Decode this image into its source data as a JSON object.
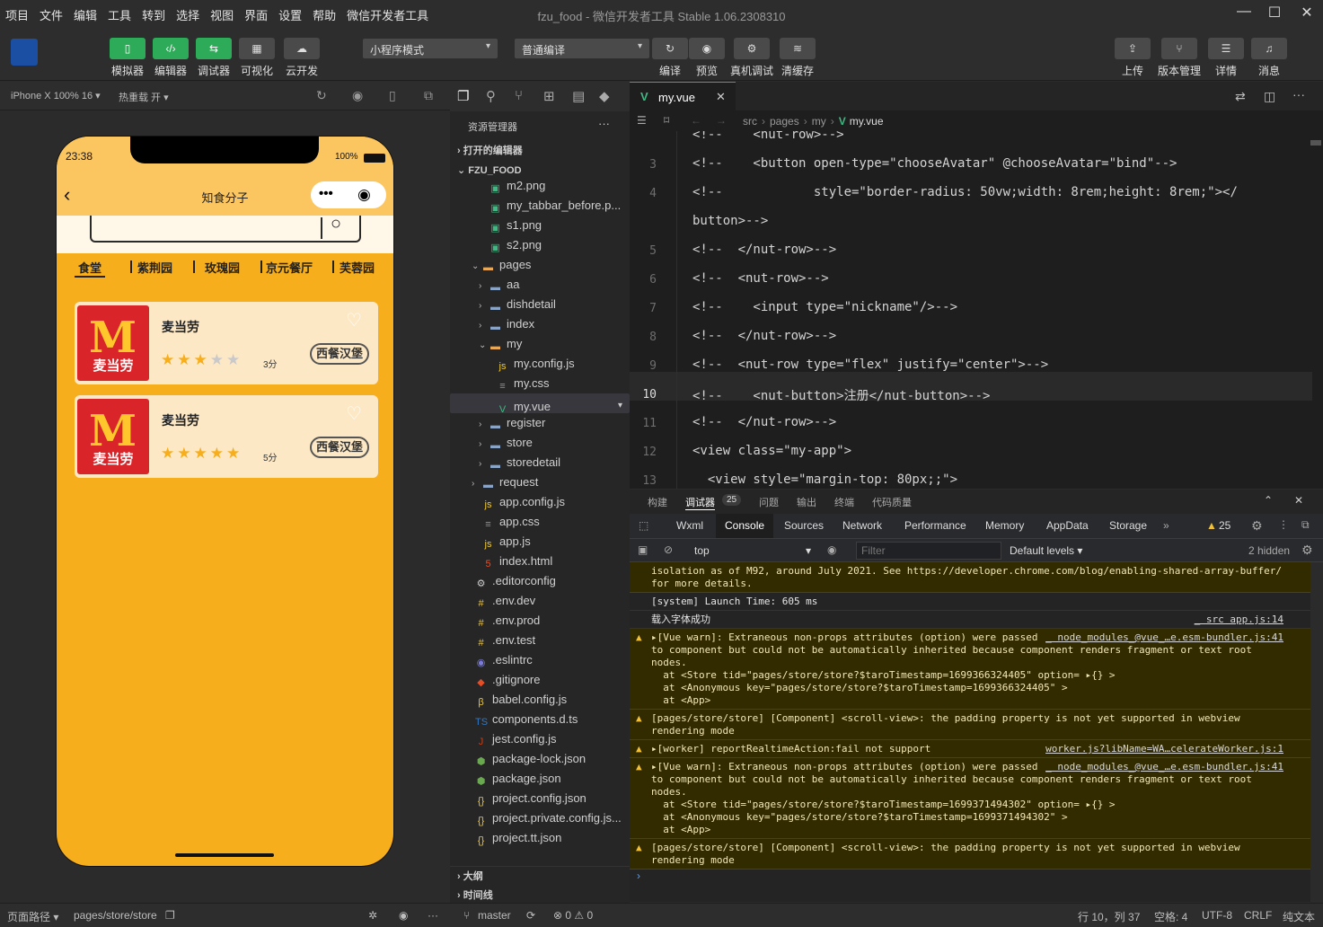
{
  "menu": [
    "项目",
    "文件",
    "编辑",
    "工具",
    "转到",
    "选择",
    "视图",
    "界面",
    "设置",
    "帮助",
    "微信开发者工具"
  ],
  "window_title": "fzu_food - 微信开发者工具 Stable 1.06.2308310",
  "toolbar": {
    "left": [
      {
        "label": "模拟器"
      },
      {
        "label": "编辑器"
      },
      {
        "label": "调试器"
      },
      {
        "label": "可视化"
      },
      {
        "label": "云开发"
      }
    ],
    "mode_select": "小程序模式",
    "compile_select": "普通编译",
    "mid": [
      {
        "label": "编译"
      },
      {
        "label": "预览"
      },
      {
        "label": "真机调试"
      },
      {
        "label": "清缓存"
      }
    ],
    "right": [
      {
        "label": "上传"
      },
      {
        "label": "版本管理"
      },
      {
        "label": "详情"
      },
      {
        "label": "消息"
      }
    ]
  },
  "sim": {
    "device": "iPhone X 100% 16 ▾",
    "hotreload": "热重载 开 ▾"
  },
  "phone": {
    "time": "23:38",
    "battery": "100%",
    "title": "知食分子",
    "tabs": [
      "食堂",
      "紫荆园",
      "玫瑰园",
      "京元餐厅",
      "芙蓉园"
    ],
    "cards": [
      {
        "name": "麦当劳",
        "logo_text": "麦当劳",
        "rating": 3,
        "score": "3分",
        "tag": "西餐汉堡"
      },
      {
        "name": "麦当劳",
        "logo_text": "麦当劳",
        "rating": 5,
        "score": "5分",
        "tag": "西餐汉堡"
      }
    ]
  },
  "explorer": {
    "title": "资源管理器",
    "open_editors": "打开的编辑器",
    "project": "FZU_FOOD",
    "items": [
      {
        "name": "m2.png",
        "depth": 3,
        "type": "img"
      },
      {
        "name": "my_tabbar_before.p...",
        "depth": 3,
        "type": "img"
      },
      {
        "name": "s1.png",
        "depth": 3,
        "type": "img"
      },
      {
        "name": "s2.png",
        "depth": 3,
        "type": "img"
      },
      {
        "name": "pages",
        "depth": 2,
        "type": "folder-open"
      },
      {
        "name": "aa",
        "depth": 3,
        "type": "folder"
      },
      {
        "name": "dishdetail",
        "depth": 3,
        "type": "folder"
      },
      {
        "name": "index",
        "depth": 3,
        "type": "folder"
      },
      {
        "name": "my",
        "depth": 3,
        "type": "folder-open"
      },
      {
        "name": "my.config.js",
        "depth": 4,
        "type": "js"
      },
      {
        "name": "my.css",
        "depth": 4,
        "type": "css"
      },
      {
        "name": "my.vue",
        "depth": 4,
        "type": "vue"
      },
      {
        "name": "register",
        "depth": 3,
        "type": "folder"
      },
      {
        "name": "store",
        "depth": 3,
        "type": "folder"
      },
      {
        "name": "storedetail",
        "depth": 3,
        "type": "folder"
      },
      {
        "name": "request",
        "depth": 2,
        "type": "folder"
      },
      {
        "name": "app.config.js",
        "depth": 2,
        "type": "js"
      },
      {
        "name": "app.css",
        "depth": 2,
        "type": "css"
      },
      {
        "name": "app.js",
        "depth": 2,
        "type": "js"
      },
      {
        "name": "index.html",
        "depth": 2,
        "type": "html"
      },
      {
        "name": ".editorconfig",
        "depth": 1,
        "type": "gear"
      },
      {
        "name": ".env.dev",
        "depth": 1,
        "type": "env"
      },
      {
        "name": ".env.prod",
        "depth": 1,
        "type": "env"
      },
      {
        "name": ".env.test",
        "depth": 1,
        "type": "env"
      },
      {
        "name": ".eslintrc",
        "depth": 1,
        "type": "eslint"
      },
      {
        "name": ".gitignore",
        "depth": 1,
        "type": "git"
      },
      {
        "name": "babel.config.js",
        "depth": 1,
        "type": "babel"
      },
      {
        "name": "components.d.ts",
        "depth": 1,
        "type": "ts"
      },
      {
        "name": "jest.config.js",
        "depth": 1,
        "type": "jest"
      },
      {
        "name": "package-lock.json",
        "depth": 1,
        "type": "node"
      },
      {
        "name": "package.json",
        "depth": 1,
        "type": "node"
      },
      {
        "name": "project.config.json",
        "depth": 1,
        "type": "json"
      },
      {
        "name": "project.private.config.js...",
        "depth": 1,
        "type": "json"
      },
      {
        "name": "project.tt.json",
        "depth": 1,
        "type": "json"
      }
    ],
    "outline": "大纲",
    "timeline": "时间线"
  },
  "editor": {
    "tab": "my.vue",
    "breadcrumb": [
      "src",
      "pages",
      "my",
      "my.vue"
    ],
    "lines": [
      {
        "n": "",
        "text": "<!--    <nut-row>-->"
      },
      {
        "n": "3",
        "text": "<!--    <button open-type=\"chooseAvatar\" @chooseAvatar=\"bind\"-->"
      },
      {
        "n": "4",
        "text": "<!--            style=\"border-radius: 50vw;width: 8rem;height: 8rem;\"></"
      },
      {
        "n": "",
        "text": "button>-->"
      },
      {
        "n": "5",
        "text": "<!--  </nut-row>-->"
      },
      {
        "n": "6",
        "text": "<!--  <nut-row>-->"
      },
      {
        "n": "7",
        "text": "<!--    <input type=\"nickname\"/>-->"
      },
      {
        "n": "8",
        "text": "<!--  </nut-row>-->"
      },
      {
        "n": "9",
        "text": "<!--  <nut-row type=\"flex\" justify=\"center\">-->"
      },
      {
        "n": "10",
        "text": "<!--    <nut-button>注册</nut-button>-->"
      },
      {
        "n": "11",
        "text": "<!--  </nut-row>-->"
      },
      {
        "n": "12",
        "text": "<view class=\"my-app\">"
      },
      {
        "n": "13",
        "text": "  <view style=\"margin-top: 80px;;\">"
      }
    ]
  },
  "panel": {
    "tabs": [
      "构建",
      "调试器",
      "问题",
      "输出",
      "终端",
      "代码质量"
    ],
    "badge": "25",
    "devtabs": [
      "Wxml",
      "Console",
      "Sources",
      "Network",
      "Performance",
      "Memory",
      "AppData",
      "Storage"
    ],
    "warn_count": "25",
    "context": "top",
    "filter_placeholder": "Filter",
    "levels": "Default levels ▾",
    "hidden": "2 hidden"
  },
  "console": [
    {
      "type": "warn",
      "lines": [
        "isolation as of M92, around July 2021. See https://developer.chrome.com/blog/enabling-shared-array-buffer/",
        "for more details."
      ],
      "src": ""
    },
    {
      "type": "info",
      "lines": [
        "[system] Launch Time: 605 ms"
      ],
      "src": ""
    },
    {
      "type": "info",
      "lines": [
        "载入字体成功"
      ],
      "src": "_ src app.js:14"
    },
    {
      "type": "warn",
      "lines": [
        "▸[Vue warn]: Extraneous non-props attributes (option) were passed",
        "to component but could not be automatically inherited because component renders fragment or text root",
        "nodes.",
        "  at <Store tid=\"pages/store/store?$taroTimestamp=1699366324405\" option= ▸{} >",
        "  at <Anonymous key=\"pages/store/store?$taroTimestamp=1699366324405\" >",
        "  at <App>"
      ],
      "src": "_ node_modules_@vue_…e.esm-bundler.js:41"
    },
    {
      "type": "warn",
      "lines": [
        "[pages/store/store] [Component] <scroll-view>: the padding property is not yet supported in webview",
        "rendering mode"
      ],
      "src": ""
    },
    {
      "type": "warn",
      "lines": [
        "▸[worker] reportRealtimeAction:fail not support"
      ],
      "src": "worker.js?libName=WA…celerateWorker.js:1"
    },
    {
      "type": "warn",
      "lines": [
        "▸[Vue warn]: Extraneous non-props attributes (option) were passed",
        "to component but could not be automatically inherited because component renders fragment or text root",
        "nodes.",
        "  at <Store tid=\"pages/store/store?$taroTimestamp=1699371494302\" option= ▸{} >",
        "  at <Anonymous key=\"pages/store/store?$taroTimestamp=1699371494302\" >",
        "  at <App>"
      ],
      "src": "_ node_modules_@vue_…e.esm-bundler.js:41"
    },
    {
      "type": "warn",
      "lines": [
        "[pages/store/store] [Component] <scroll-view>: the padding property is not yet supported in webview",
        "rendering mode"
      ],
      "src": ""
    }
  ],
  "status": {
    "path_label": "页面路径 ▾",
    "path": "pages/store/store",
    "branch": "master",
    "errors": "⊗ 0 ⚠ 0",
    "pos": "行 10，列 37",
    "spaces": "空格: 4",
    "enc": "UTF-8",
    "eol": "CRLF",
    "lang": "纯文本"
  }
}
